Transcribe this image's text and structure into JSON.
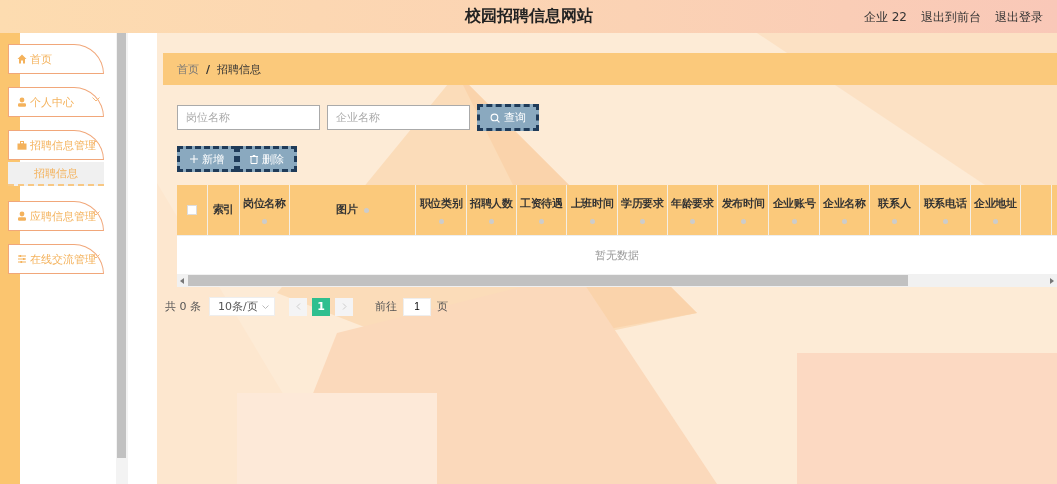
{
  "header": {
    "title": "校园招聘信息网站",
    "user": "企业 22",
    "links": [
      "退出到前台",
      "退出登录"
    ]
  },
  "sidebar": {
    "items": [
      {
        "label": "首页",
        "has_children": false
      },
      {
        "label": "个人中心",
        "has_children": true,
        "expanded": false
      },
      {
        "label": "招聘信息管理",
        "has_children": true,
        "expanded": true,
        "children": [
          {
            "label": "招聘信息",
            "selected": true
          }
        ]
      },
      {
        "label": "应聘信息管理",
        "has_children": true,
        "expanded": false
      },
      {
        "label": "在线交流管理",
        "has_children": true,
        "expanded": false
      }
    ]
  },
  "breadcrumb": {
    "items": [
      "首页",
      "招聘信息"
    ],
    "separator": "/"
  },
  "search": {
    "fields": [
      {
        "placeholder": "岗位名称"
      },
      {
        "placeholder": "企业名称"
      }
    ],
    "button": "查询"
  },
  "actions": [
    "新增",
    "删除"
  ],
  "table": {
    "columns": [
      {
        "label": "索引",
        "sortable": false
      },
      {
        "label": "岗位名称",
        "sortable": true
      },
      {
        "label": "图片",
        "sortable": true
      },
      {
        "label": "职位类别",
        "sortable": true
      },
      {
        "label": "招聘人数",
        "sortable": true
      },
      {
        "label": "工资待遇",
        "sortable": true
      },
      {
        "label": "上班时间",
        "sortable": true
      },
      {
        "label": "学历要求",
        "sortable": true
      },
      {
        "label": "年龄要求",
        "sortable": true
      },
      {
        "label": "发布时间",
        "sortable": true
      },
      {
        "label": "企业账号",
        "sortable": true
      },
      {
        "label": "企业名称",
        "sortable": true
      },
      {
        "label": "联系人",
        "sortable": true
      },
      {
        "label": "联系电话",
        "sortable": true
      },
      {
        "label": "企业地址",
        "sortable": true
      }
    ],
    "select_all_checked": false,
    "empty_text": "暂无数据"
  },
  "pagination": {
    "total": "共 0 条",
    "page_size": "10条/页",
    "pages": [
      {
        "label": "1",
        "selected": true
      }
    ],
    "goto_label": "前往",
    "goto_value": "1",
    "goto_suffix": "页"
  }
}
